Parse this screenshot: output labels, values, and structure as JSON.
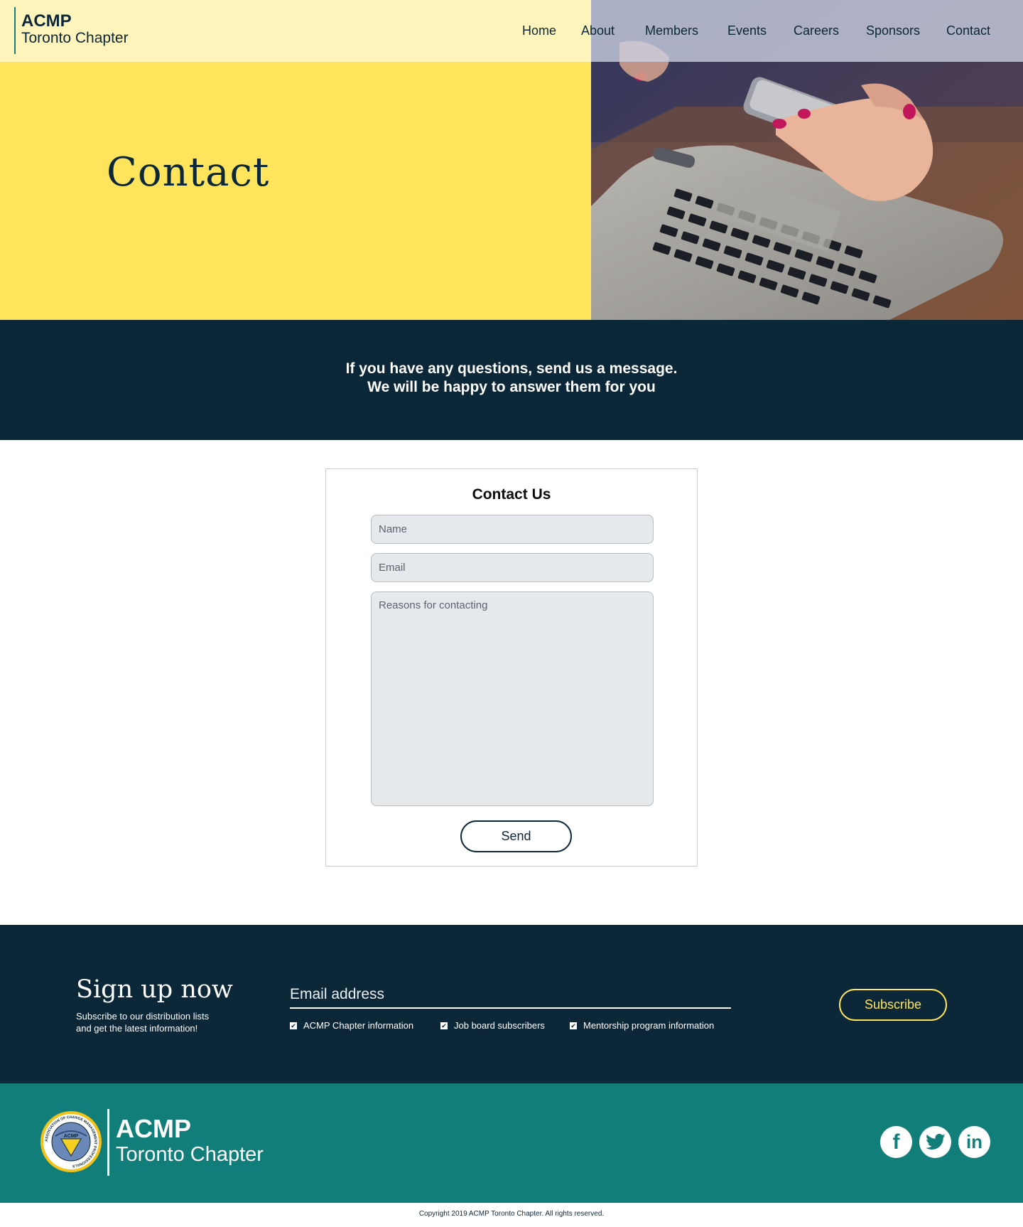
{
  "header": {
    "logo_line1": "ACMP",
    "logo_line2": "Toronto Chapter",
    "nav": [
      "Home",
      "About",
      "Members",
      "Events",
      "Careers",
      "Sponsors",
      "Contact"
    ]
  },
  "hero": {
    "title": "Contact",
    "image_alt": "hands holding a phone over a laptop"
  },
  "banner": {
    "line1": "If you have any questions, send us a message.",
    "line2": "We will be happy to answer them for you"
  },
  "contact_form": {
    "title": "Contact Us",
    "name_placeholder": "Name",
    "email_placeholder": "Email",
    "reason_placeholder": "Reasons for contacting",
    "send_label": "Send"
  },
  "signup": {
    "title": "Sign up now",
    "subtitle_line1": "Subscribe to our distribution lists",
    "subtitle_line2": "and get the latest information!",
    "email_placeholder": "Email address",
    "options": [
      "ACMP Chapter information",
      "Job board subscribers",
      "Mentorship program information"
    ],
    "subscribe_label": "Subscribe"
  },
  "footer": {
    "logo_line1": "ACMP",
    "logo_line2": "Toronto Chapter",
    "seal_text": "ASSOCIATION OF CHANGE MANAGEMENT PROFESSIONALS",
    "seal_center": "ACMP",
    "social": [
      "facebook-icon",
      "twitter-icon",
      "linkedin-icon"
    ]
  },
  "copyright": "Copyright 2019 ACMP Toronto Chapter. All rights reserved.",
  "colors": {
    "navy": "#0b2738",
    "yellow": "#ffe45c",
    "teal": "#127e79"
  }
}
